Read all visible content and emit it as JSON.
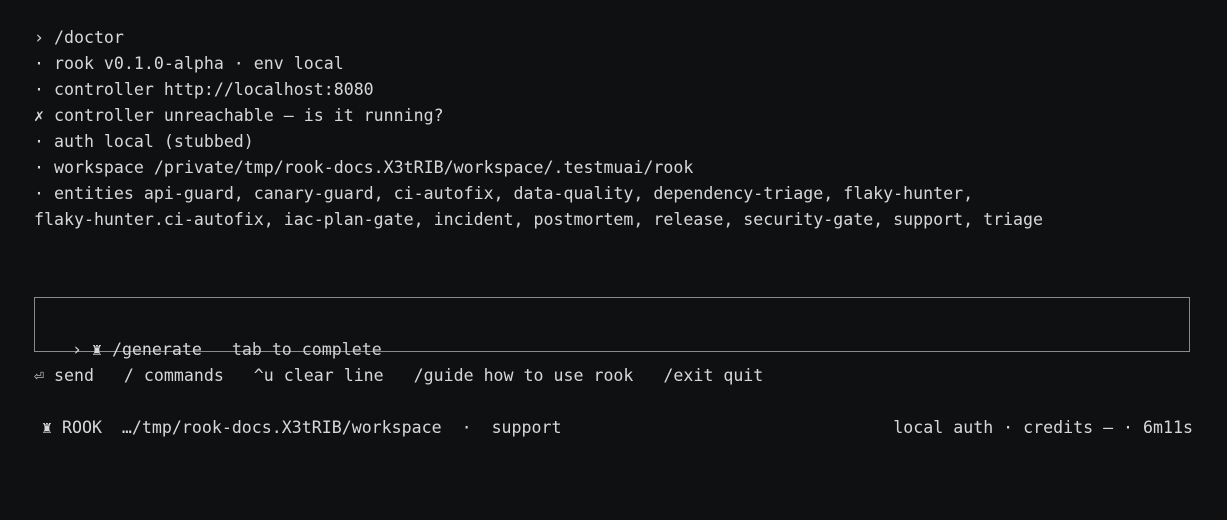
{
  "terminal": {
    "lines": [
      "› /doctor",
      "· rook v0.1.0-alpha · env local",
      "· controller http://localhost:8080",
      "✗ controller unreachable — is it running?",
      "· auth local (stubbed)",
      "· workspace /private/tmp/rook-docs.X3tRIB/workspace/.testmuai/rook",
      "· entities api-guard, canary-guard, ci-autofix, data-quality, dependency-triage, flaky-hunter,",
      "flaky-hunter.ci-autofix, iac-plan-gate, incident, postmortem, release, security-gate, support, triage"
    ]
  },
  "prompt": {
    "cursor": "› ♜ ",
    "suggestion": "/generate",
    "tip": "tab to complete"
  },
  "shortcuts": {
    "text": "⏎ send   / commands   ^u clear line   /guide how to use rook   /exit quit"
  },
  "status": {
    "left": "♜ ROOK  …/tmp/rook-docs.X3tRIB/workspace  ·  support",
    "right": "local auth · credits — · 6m11s"
  }
}
